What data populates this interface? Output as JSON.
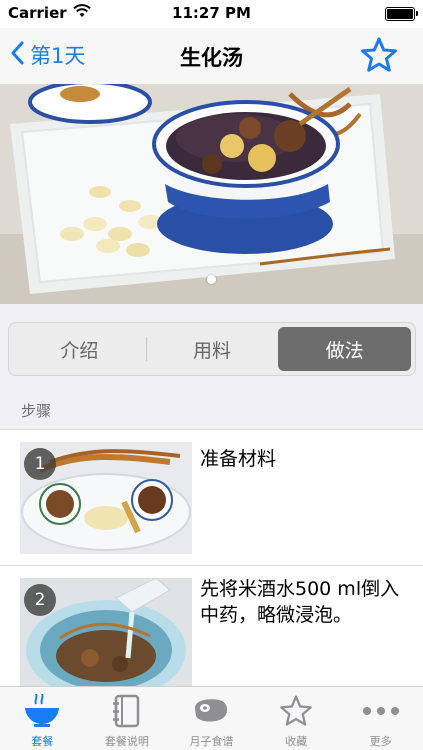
{
  "status_bar": {
    "carrier": "Carrier",
    "time": "11:27 PM",
    "icons": [
      "wifi-icon",
      "battery-icon"
    ]
  },
  "nav": {
    "back_label": "第1天",
    "title": "生化汤",
    "favorite_icon": "star-icon"
  },
  "hero": {
    "icon": "soup-photo",
    "page_count": 1,
    "current_page": 1
  },
  "segments": {
    "items": [
      "介绍",
      "用料",
      "做法"
    ],
    "selected": "做法"
  },
  "section": {
    "title": "步骤"
  },
  "steps": [
    {
      "number": "1",
      "text": "准备材料",
      "image": "ingredients-photo"
    },
    {
      "number": "2",
      "text": "先将米酒水500 ml倒入中药，略微浸泡。",
      "image": "soaking-photo"
    }
  ],
  "tab_bar": {
    "items": [
      {
        "label": "套餐",
        "icon": "bowl-icon",
        "active": true
      },
      {
        "label": "套餐说明",
        "icon": "notebook-icon",
        "active": false
      },
      {
        "label": "月子食谱",
        "icon": "meat-icon",
        "active": false
      },
      {
        "label": "收藏",
        "icon": "star-outline-icon",
        "active": false
      },
      {
        "label": "更多",
        "icon": "more-dots-icon",
        "active": false
      }
    ]
  },
  "colors": {
    "accent": "#1a7cf5",
    "segment_active": "#6d6d6d",
    "grouped_background": "#efeff4"
  }
}
